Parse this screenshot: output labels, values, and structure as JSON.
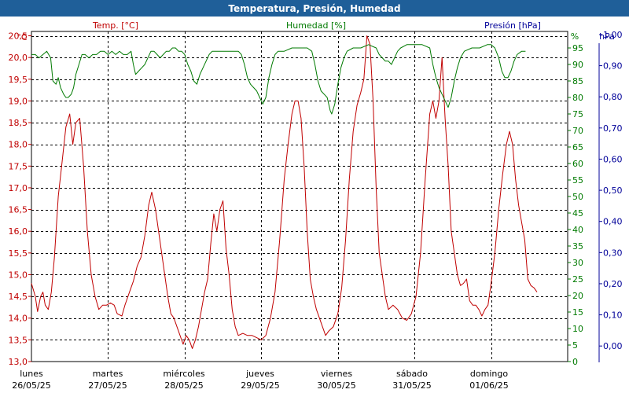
{
  "title": "Temperatura, Presión, Humedad",
  "colors": {
    "titlebar": "#1f5f99",
    "temperature": "#c00000",
    "humidity": "#007a00",
    "pressure": "#000099",
    "grid": "#000000",
    "plot_bg": "#ffffff"
  },
  "chart_data": {
    "type": "line",
    "axes": {
      "temperature": {
        "unit": "°C",
        "label": "Temp. [°C]",
        "range": [
          13.0,
          20.6
        ],
        "ticks": [
          "13,0",
          "13,5",
          "14,0",
          "14,5",
          "15,0",
          "15,5",
          "16,0",
          "16,5",
          "17,0",
          "17,5",
          "18,0",
          "18,5",
          "19,0",
          "19,5",
          "20,0",
          "20,5"
        ]
      },
      "humidity": {
        "unit": "%",
        "label": "Humedad [%]",
        "range": [
          0,
          100
        ],
        "ticks": [
          "0",
          "5",
          "10",
          "15",
          "20",
          "25",
          "30",
          "35",
          "40",
          "45",
          "50",
          "55",
          "60",
          "65",
          "70",
          "75",
          "80",
          "85",
          "90",
          "95"
        ]
      },
      "pressure": {
        "unit": "hPa",
        "label": "Presión [hPa]",
        "range": [
          -0.05,
          1.01
        ],
        "ticks": [
          "0,00",
          "0,10",
          "0,20",
          "0,30",
          "0,40",
          "0,50",
          "0,60",
          "0,70",
          "0,80",
          "0,90",
          "1,00"
        ]
      }
    },
    "days": [
      {
        "name": "lunes",
        "date": "26/05/25"
      },
      {
        "name": "martes",
        "date": "27/05/25"
      },
      {
        "name": "miércoles",
        "date": "28/05/25"
      },
      {
        "name": "jueves",
        "date": "29/05/25"
      },
      {
        "name": "viernes",
        "date": "30/05/25"
      },
      {
        "name": "sábado",
        "date": "31/05/25"
      },
      {
        "name": "domingo",
        "date": "01/06/25"
      }
    ],
    "x_range_days": [
      0,
      7
    ],
    "grid": true,
    "series": [
      {
        "name": "Temp. [°C]",
        "axis": "temperature",
        "points": [
          [
            0.0,
            14.8
          ],
          [
            0.05,
            14.5
          ],
          [
            0.08,
            14.15
          ],
          [
            0.12,
            14.5
          ],
          [
            0.15,
            14.6
          ],
          [
            0.18,
            14.3
          ],
          [
            0.22,
            14.2
          ],
          [
            0.26,
            14.6
          ],
          [
            0.3,
            15.4
          ],
          [
            0.35,
            16.8
          ],
          [
            0.4,
            17.6
          ],
          [
            0.45,
            18.4
          ],
          [
            0.5,
            18.7
          ],
          [
            0.54,
            18.0
          ],
          [
            0.58,
            18.5
          ],
          [
            0.63,
            18.6
          ],
          [
            0.68,
            17.5
          ],
          [
            0.73,
            16.0
          ],
          [
            0.78,
            15.0
          ],
          [
            0.83,
            14.5
          ],
          [
            0.88,
            14.2
          ],
          [
            0.93,
            14.3
          ],
          [
            0.98,
            14.3
          ],
          [
            1.03,
            14.35
          ],
          [
            1.08,
            14.3
          ],
          [
            1.12,
            14.1
          ],
          [
            1.18,
            14.05
          ],
          [
            1.22,
            14.3
          ],
          [
            1.28,
            14.6
          ],
          [
            1.33,
            14.85
          ],
          [
            1.38,
            15.2
          ],
          [
            1.43,
            15.4
          ],
          [
            1.48,
            15.9
          ],
          [
            1.53,
            16.6
          ],
          [
            1.57,
            16.9
          ],
          [
            1.62,
            16.5
          ],
          [
            1.66,
            16.0
          ],
          [
            1.7,
            15.5
          ],
          [
            1.74,
            15.0
          ],
          [
            1.78,
            14.5
          ],
          [
            1.82,
            14.1
          ],
          [
            1.86,
            14.0
          ],
          [
            1.9,
            13.8
          ],
          [
            1.94,
            13.6
          ],
          [
            1.98,
            13.4
          ],
          [
            2.02,
            13.6
          ],
          [
            2.06,
            13.5
          ],
          [
            2.1,
            13.3
          ],
          [
            2.14,
            13.5
          ],
          [
            2.18,
            13.8
          ],
          [
            2.22,
            14.2
          ],
          [
            2.26,
            14.6
          ],
          [
            2.3,
            14.9
          ],
          [
            2.34,
            15.7
          ],
          [
            2.38,
            16.4
          ],
          [
            2.42,
            16.0
          ],
          [
            2.46,
            16.5
          ],
          [
            2.5,
            16.7
          ],
          [
            2.54,
            15.6
          ],
          [
            2.58,
            15.0
          ],
          [
            2.62,
            14.2
          ],
          [
            2.66,
            13.8
          ],
          [
            2.7,
            13.6
          ],
          [
            2.76,
            13.65
          ],
          [
            2.82,
            13.6
          ],
          [
            2.88,
            13.6
          ],
          [
            2.94,
            13.55
          ],
          [
            3.0,
            13.5
          ],
          [
            3.06,
            13.6
          ],
          [
            3.12,
            14.0
          ],
          [
            3.18,
            14.6
          ],
          [
            3.24,
            15.8
          ],
          [
            3.3,
            17.2
          ],
          [
            3.35,
            18.0
          ],
          [
            3.4,
            18.7
          ],
          [
            3.44,
            19.0
          ],
          [
            3.48,
            19.0
          ],
          [
            3.52,
            18.6
          ],
          [
            3.56,
            17.5
          ],
          [
            3.6,
            16.0
          ],
          [
            3.64,
            14.9
          ],
          [
            3.68,
            14.5
          ],
          [
            3.72,
            14.2
          ],
          [
            3.76,
            14.0
          ],
          [
            3.8,
            13.8
          ],
          [
            3.84,
            13.6
          ],
          [
            3.88,
            13.7
          ],
          [
            3.94,
            13.8
          ],
          [
            4.0,
            14.1
          ],
          [
            4.05,
            14.7
          ],
          [
            4.1,
            15.8
          ],
          [
            4.15,
            17.2
          ],
          [
            4.2,
            18.3
          ],
          [
            4.25,
            18.9
          ],
          [
            4.3,
            19.2
          ],
          [
            4.34,
            19.5
          ],
          [
            4.38,
            20.5
          ],
          [
            4.42,
            20.3
          ],
          [
            4.46,
            19.0
          ],
          [
            4.5,
            17.0
          ],
          [
            4.54,
            15.5
          ],
          [
            4.58,
            15.0
          ],
          [
            4.62,
            14.5
          ],
          [
            4.66,
            14.2
          ],
          [
            4.72,
            14.3
          ],
          [
            4.78,
            14.2
          ],
          [
            4.84,
            14.0
          ],
          [
            4.9,
            13.95
          ],
          [
            4.96,
            14.1
          ],
          [
            5.02,
            14.5
          ],
          [
            5.08,
            15.5
          ],
          [
            5.14,
            17.2
          ],
          [
            5.2,
            18.7
          ],
          [
            5.24,
            19.0
          ],
          [
            5.28,
            18.6
          ],
          [
            5.32,
            19.0
          ],
          [
            5.36,
            20.0
          ],
          [
            5.4,
            18.6
          ],
          [
            5.44,
            17.5
          ],
          [
            5.48,
            16.0
          ],
          [
            5.52,
            15.5
          ],
          [
            5.56,
            15.0
          ],
          [
            5.6,
            14.75
          ],
          [
            5.64,
            14.8
          ],
          [
            5.68,
            14.9
          ],
          [
            5.72,
            14.4
          ],
          [
            5.76,
            14.3
          ],
          [
            5.8,
            14.3
          ],
          [
            5.84,
            14.2
          ],
          [
            5.88,
            14.05
          ],
          [
            5.92,
            14.2
          ],
          [
            5.96,
            14.3
          ],
          [
            6.0,
            14.8
          ],
          [
            6.05,
            15.5
          ],
          [
            6.1,
            16.5
          ],
          [
            6.15,
            17.3
          ],
          [
            6.2,
            18.0
          ],
          [
            6.24,
            18.3
          ],
          [
            6.28,
            18.0
          ],
          [
            6.32,
            17.2
          ],
          [
            6.36,
            16.6
          ],
          [
            6.4,
            16.2
          ],
          [
            6.44,
            15.8
          ],
          [
            6.48,
            14.9
          ],
          [
            6.52,
            14.75
          ],
          [
            6.56,
            14.7
          ],
          [
            6.6,
            14.6
          ]
        ]
      },
      {
        "name": "Humedad [%]",
        "axis": "humidity",
        "points": [
          [
            0.0,
            93
          ],
          [
            0.05,
            93
          ],
          [
            0.1,
            92
          ],
          [
            0.15,
            93
          ],
          [
            0.2,
            94
          ],
          [
            0.25,
            92
          ],
          [
            0.28,
            85
          ],
          [
            0.32,
            84
          ],
          [
            0.35,
            86
          ],
          [
            0.38,
            83
          ],
          [
            0.42,
            81
          ],
          [
            0.45,
            80
          ],
          [
            0.48,
            80
          ],
          [
            0.52,
            81
          ],
          [
            0.55,
            83
          ],
          [
            0.58,
            87
          ],
          [
            0.62,
            90
          ],
          [
            0.66,
            93
          ],
          [
            0.7,
            93
          ],
          [
            0.75,
            92
          ],
          [
            0.8,
            93
          ],
          [
            0.85,
            93
          ],
          [
            0.9,
            94
          ],
          [
            0.95,
            94
          ],
          [
            1.0,
            93
          ],
          [
            1.05,
            94
          ],
          [
            1.1,
            93
          ],
          [
            1.15,
            94
          ],
          [
            1.2,
            93
          ],
          [
            1.25,
            93
          ],
          [
            1.3,
            94
          ],
          [
            1.33,
            90
          ],
          [
            1.36,
            87
          ],
          [
            1.4,
            88
          ],
          [
            1.44,
            89
          ],
          [
            1.48,
            90
          ],
          [
            1.52,
            92
          ],
          [
            1.56,
            94
          ],
          [
            1.6,
            94
          ],
          [
            1.64,
            93
          ],
          [
            1.68,
            92
          ],
          [
            1.72,
            93
          ],
          [
            1.76,
            94
          ],
          [
            1.8,
            94
          ],
          [
            1.84,
            95
          ],
          [
            1.88,
            95
          ],
          [
            1.92,
            94
          ],
          [
            1.96,
            94
          ],
          [
            2.0,
            93
          ],
          [
            2.04,
            90
          ],
          [
            2.08,
            88
          ],
          [
            2.12,
            85
          ],
          [
            2.16,
            84
          ],
          [
            2.2,
            87
          ],
          [
            2.24,
            89
          ],
          [
            2.28,
            91
          ],
          [
            2.32,
            93
          ],
          [
            2.36,
            94
          ],
          [
            2.4,
            94
          ],
          [
            2.5,
            94
          ],
          [
            2.6,
            94
          ],
          [
            2.7,
            94
          ],
          [
            2.74,
            93
          ],
          [
            2.78,
            90
          ],
          [
            2.82,
            86
          ],
          [
            2.86,
            84
          ],
          [
            2.9,
            83
          ],
          [
            2.94,
            82
          ],
          [
            2.98,
            80
          ],
          [
            3.02,
            78
          ],
          [
            3.06,
            80
          ],
          [
            3.1,
            86
          ],
          [
            3.14,
            90
          ],
          [
            3.18,
            93
          ],
          [
            3.22,
            94
          ],
          [
            3.3,
            94
          ],
          [
            3.4,
            95
          ],
          [
            3.5,
            95
          ],
          [
            3.6,
            95
          ],
          [
            3.66,
            94
          ],
          [
            3.7,
            90
          ],
          [
            3.74,
            85
          ],
          [
            3.78,
            82
          ],
          [
            3.82,
            81
          ],
          [
            3.86,
            80
          ],
          [
            3.9,
            76
          ],
          [
            3.92,
            75
          ],
          [
            3.96,
            78
          ],
          [
            4.0,
            84
          ],
          [
            4.04,
            89
          ],
          [
            4.08,
            92
          ],
          [
            4.12,
            94
          ],
          [
            4.2,
            95
          ],
          [
            4.3,
            95
          ],
          [
            4.4,
            96
          ],
          [
            4.5,
            95
          ],
          [
            4.54,
            93
          ],
          [
            4.58,
            92
          ],
          [
            4.62,
            91
          ],
          [
            4.66,
            91
          ],
          [
            4.7,
            90
          ],
          [
            4.74,
            92
          ],
          [
            4.78,
            94
          ],
          [
            4.82,
            95
          ],
          [
            4.9,
            96
          ],
          [
            5.0,
            96
          ],
          [
            5.1,
            96
          ],
          [
            5.2,
            95
          ],
          [
            5.24,
            90
          ],
          [
            5.28,
            86
          ],
          [
            5.32,
            83
          ],
          [
            5.36,
            81
          ],
          [
            5.4,
            79
          ],
          [
            5.44,
            77
          ],
          [
            5.48,
            80
          ],
          [
            5.52,
            85
          ],
          [
            5.56,
            89
          ],
          [
            5.6,
            92
          ],
          [
            5.65,
            94
          ],
          [
            5.75,
            95
          ],
          [
            5.85,
            95
          ],
          [
            5.95,
            96
          ],
          [
            6.0,
            96
          ],
          [
            6.05,
            95
          ],
          [
            6.1,
            92
          ],
          [
            6.14,
            88
          ],
          [
            6.18,
            86
          ],
          [
            6.22,
            86
          ],
          [
            6.26,
            88
          ],
          [
            6.3,
            91
          ],
          [
            6.34,
            93
          ],
          [
            6.4,
            94
          ],
          [
            6.45,
            94
          ]
        ]
      }
    ]
  },
  "day_axis": {
    "start_x": 40,
    "end_x": 722,
    "label_x": [
      40,
      137,
      234,
      331,
      428,
      524,
      622
    ]
  }
}
